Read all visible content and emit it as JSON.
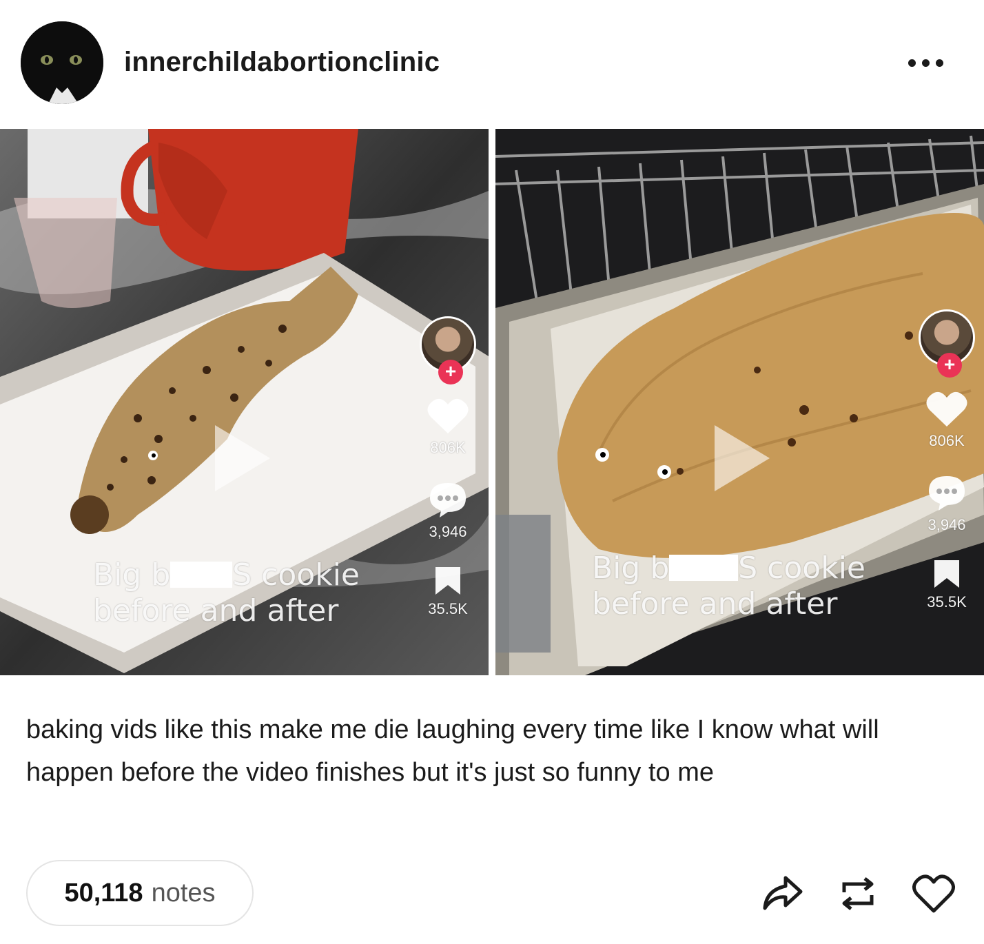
{
  "header": {
    "username": "innerchildabortionclinic",
    "avatar_icon": "black-cat-avatar",
    "more_icon": "ellipsis-icon"
  },
  "images": [
    {
      "overlay_line1_a": "Big b",
      "overlay_line1_b": "S cookie",
      "overlay_line2": "before and after",
      "likes": "806K",
      "comments": "3,946",
      "saves": "35.5K"
    },
    {
      "overlay_line1_a": "Big b",
      "overlay_line1_b": "S cookie",
      "overlay_line2": "before and after",
      "likes": "806K",
      "comments": "3,946",
      "saves": "35.5K"
    }
  ],
  "caption": "baking vids like this make me die laughing every time like I know what will happen before the video finishes but it's just so funny to me",
  "footer": {
    "notes_count": "50,118",
    "notes_label": "notes",
    "share_icon": "share-icon",
    "reblog_icon": "reblog-icon",
    "like_icon": "heart-icon"
  },
  "colors": {
    "tiktok_plus": "#ea3356",
    "text": "#1b1b1b",
    "border": "#e4e4e4"
  }
}
